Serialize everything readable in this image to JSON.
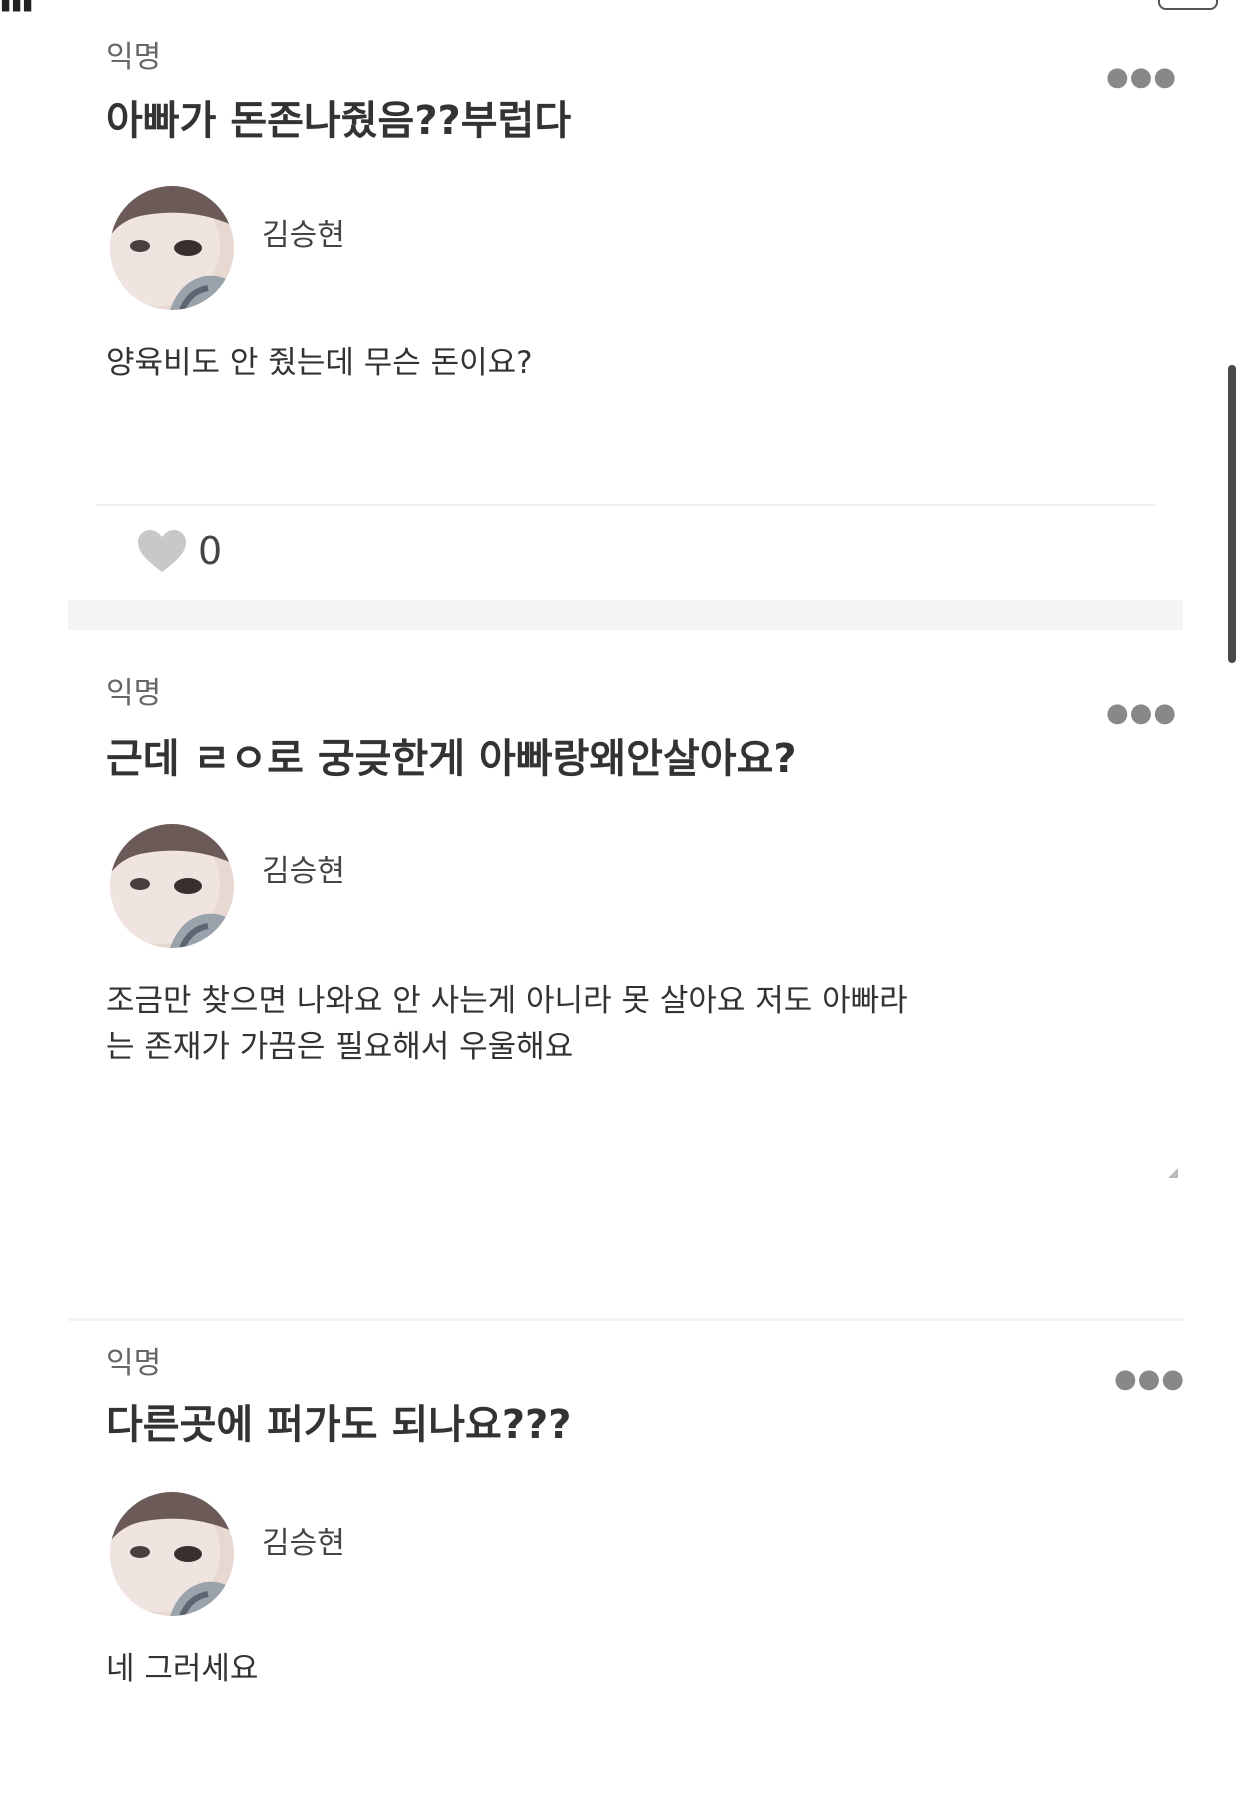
{
  "status_bar": {
    "signal_icon": "signal-bars-icon",
    "battery_icon": "battery-icon"
  },
  "posts": [
    {
      "label": "익명",
      "question": "아빠가 돈존나줬음??부럽다",
      "author": "김승현",
      "answer": "양육비도 안 줬는데 무슨 돈이요?",
      "likes": "0"
    },
    {
      "label": "익명",
      "question": "근데 ㄹㅇ로 궁긎한게 아빠랑왜안살아요?",
      "author": "김승현",
      "answer": "조금만 찾으면 나와요 안 사는게 아니라 못 살아요 저도 아빠라\n는 존재가 가끔은 필요해서 우울해요"
    },
    {
      "label": "익명",
      "question": "다른곳에 퍼가도 되나요???",
      "author": "김승현",
      "answer": "네 그러세요"
    }
  ],
  "more_icon": "more-dots-icon",
  "like_icon": "heart-icon",
  "colors": {
    "text": "#333333",
    "muted": "#666666",
    "heart": "#c8c8c8",
    "divider": "#f1f1f1"
  }
}
